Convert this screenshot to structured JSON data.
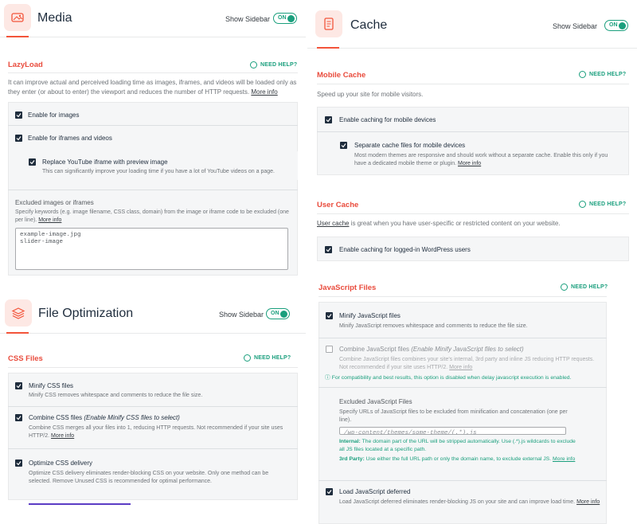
{
  "sidebar_toggle": {
    "label": "Show Sidebar",
    "state": "ON"
  },
  "need_help": "NEED HELP?",
  "more_info": "More info",
  "media": {
    "title": "Media",
    "icon": "media-icon",
    "lazyload": {
      "title": "LazyLoad",
      "desc": "It can improve actual and perceived loading time as images, iframes, and videos will be loaded only as they enter (or about to enter) the viewport and reduces the number of HTTP requests.",
      "options": [
        {
          "label": "Enable for images",
          "checked": true
        },
        {
          "label": "Enable for iframes and videos",
          "checked": true
        }
      ],
      "youtube": {
        "label": "Replace YouTube iframe with preview image",
        "desc": "This can significantly improve your loading time if you have a lot of YouTube videos on a page.",
        "checked": true
      },
      "excluded": {
        "title": "Excluded images or iframes",
        "desc": "Specify keywords (e.g. image filename, CSS class, domain) from the image or iframe code to be excluded (one per line).",
        "value": "example-image.jpg\nslider-image"
      }
    }
  },
  "cache": {
    "title": "Cache",
    "icon": "cache-icon",
    "mobile": {
      "title": "Mobile Cache",
      "desc": "Speed up your site for mobile visitors.",
      "option": {
        "label": "Enable caching for mobile devices",
        "checked": true
      },
      "separate": {
        "label": "Separate cache files for mobile devices",
        "desc": "Most modern themes are responsive and should work without a separate cache. Enable this only if you have a dedicated mobile theme or plugin.",
        "checked": true
      }
    },
    "user": {
      "title": "User Cache",
      "desc_link": "User cache",
      "desc": " is great when you have user-specific or restricted content on your website.",
      "option": {
        "label": "Enable caching for logged-in WordPress users",
        "checked": true
      }
    }
  },
  "file": {
    "title": "File Optimization",
    "icon": "layers-icon",
    "css": {
      "title": "CSS Files",
      "minify": {
        "label": "Minify CSS files",
        "desc": "Minify CSS removes whitespace and comments to reduce the file size.",
        "checked": true
      },
      "combine": {
        "label": "Combine CSS files ",
        "label_em": "(Enable Minify CSS files to select)",
        "desc": "Combine CSS merges all your files into 1, reducing HTTP requests. Not recommended if your site uses HTTP/2.",
        "checked": true
      },
      "optimize": {
        "label": "Optimize CSS delivery",
        "desc": "Optimize CSS delivery eliminates render-blocking CSS on your website. Only one method can be selected. Remove Unused CSS is recommended for optimal performance.",
        "checked": true
      }
    }
  },
  "js": {
    "title": "JavaScript Files",
    "minify": {
      "label": "Minify JavaScript files",
      "desc": "Minify JavaScript removes whitespace and comments to reduce the file size.",
      "checked": true
    },
    "combine": {
      "label": "Combine JavaScript files ",
      "label_em": "(Enable Minify JavaScript files to select)",
      "desc": "Combine JavaScript files combines your site's internal, 3rd party and inline JS reducing HTTP requests. Not recommended if your site uses HTTP/2.",
      "checked": false
    },
    "compat_note": "For compatibility and best results, this option is disabled when delay javascript execution is enabled.",
    "excluded": {
      "title": "Excluded JavaScript Files",
      "desc": "Specify URLs of JavaScript files to be excluded from minification and concatenation (one per line).",
      "value": "/wp-content/themes/some-theme/(.*).js",
      "internal_label": "Internal:",
      "internal": " The domain part of the URL will be stripped automatically. Use (.*).js wildcards to exclude all JS files located at a specific path.",
      "third_label": "3rd Party:",
      "third": " Use either the full URL path or only the domain name, to exclude external JS."
    },
    "defer": {
      "label": "Load JavaScript deferred",
      "desc": "Load JavaScript deferred eliminates render-blocking JS on your site and can improve load time.",
      "checked": true
    }
  }
}
